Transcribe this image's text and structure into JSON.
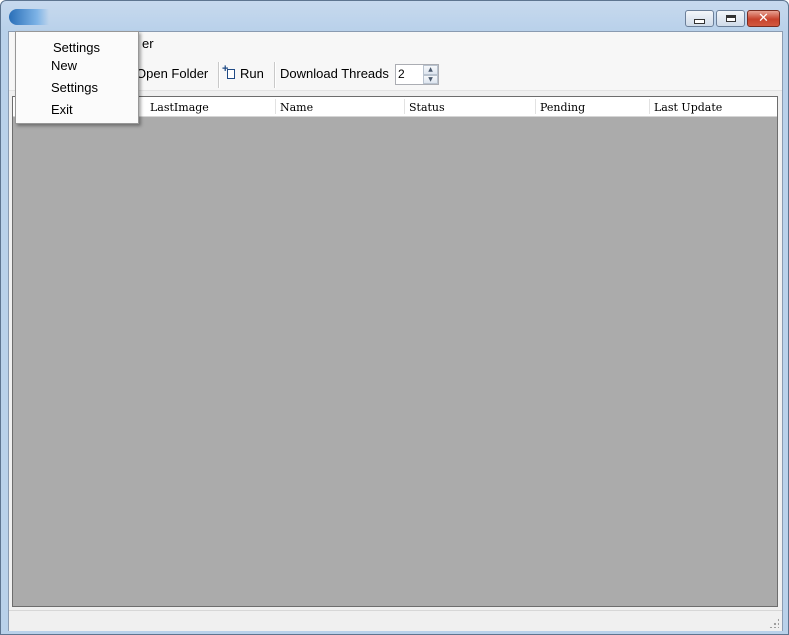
{
  "window": {
    "controls": {
      "minimize": "minimize",
      "maximize": "maximize",
      "close": "✕"
    }
  },
  "menubar": {
    "partial_label": "er"
  },
  "toolbar": {
    "open_folder": "Open Folder",
    "run": "Run",
    "threads_label": "Download Threads",
    "threads_value": "2"
  },
  "grid": {
    "columns": [
      "LastImage",
      "Name",
      "Status",
      "Pending",
      "Last Update"
    ],
    "rows": []
  },
  "dropdown": {
    "header": "Settings",
    "items": [
      "New",
      "Settings",
      "Exit"
    ]
  },
  "colors": {
    "grid_background": "#ababab",
    "accent": "#2a6fb8"
  }
}
